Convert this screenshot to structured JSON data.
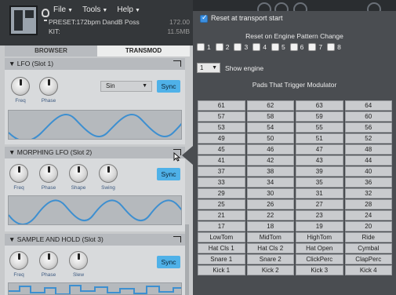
{
  "menu": {
    "file": "File",
    "tools": "Tools",
    "help": "Help"
  },
  "preset": {
    "preset_label": "PRESET:",
    "preset_name": "172bpm DandB Poss",
    "preset_value": "172.00",
    "kit_label": "KIT:",
    "kit_value": "11.5MB"
  },
  "tabs": [
    "BROWSER",
    "TRANSMOD"
  ],
  "sections": [
    {
      "title": "▼ LFO (Slot 1)",
      "knobs": [
        "Freq",
        "Phase"
      ],
      "waveform": "Sin",
      "sync": "Sync"
    },
    {
      "title": "▼ MORPHING LFO (Slot 2)",
      "knobs": [
        "Freq",
        "Phase",
        "Shape",
        "Swing"
      ],
      "sync": "Sync"
    },
    {
      "title": "▼ SAMPLE AND HOLD (Slot 3)",
      "knobs": [
        "Freq",
        "Phase",
        "Slew"
      ],
      "sync": "Sync"
    }
  ],
  "popover": {
    "reset_transport": "Reset at transport start",
    "reset_transport_checked": true,
    "reset_engine_title": "Reset on Engine Pattern Change",
    "engine_checks": [
      "1",
      "2",
      "3",
      "4",
      "5",
      "6",
      "7",
      "8"
    ],
    "engine_select": "1",
    "show_engine": "Show engine",
    "pads_title": "Pads That Trigger Modulator",
    "pads": [
      "61",
      "62",
      "63",
      "64",
      "57",
      "58",
      "59",
      "60",
      "53",
      "54",
      "55",
      "56",
      "49",
      "50",
      "51",
      "52",
      "45",
      "46",
      "47",
      "48",
      "41",
      "42",
      "43",
      "44",
      "37",
      "38",
      "39",
      "40",
      "33",
      "34",
      "35",
      "36",
      "29",
      "30",
      "31",
      "32",
      "25",
      "26",
      "27",
      "28",
      "21",
      "22",
      "23",
      "24",
      "17",
      "18",
      "19",
      "20",
      "LowTom",
      "MidTom",
      "HighTom",
      "Ride",
      "Hat Cls 1",
      "Hat Cls 2",
      "Hat Open",
      "Cymbal",
      "Snare 1",
      "Snare 2",
      "ClickPerc",
      "ClapPerc",
      "Kick 1",
      "Kick 2",
      "Kick 3",
      "Kick 4"
    ]
  },
  "colors": {
    "accent": "#4fb1e8",
    "panel": "#4a4d51",
    "pad": "#c9cbce"
  }
}
